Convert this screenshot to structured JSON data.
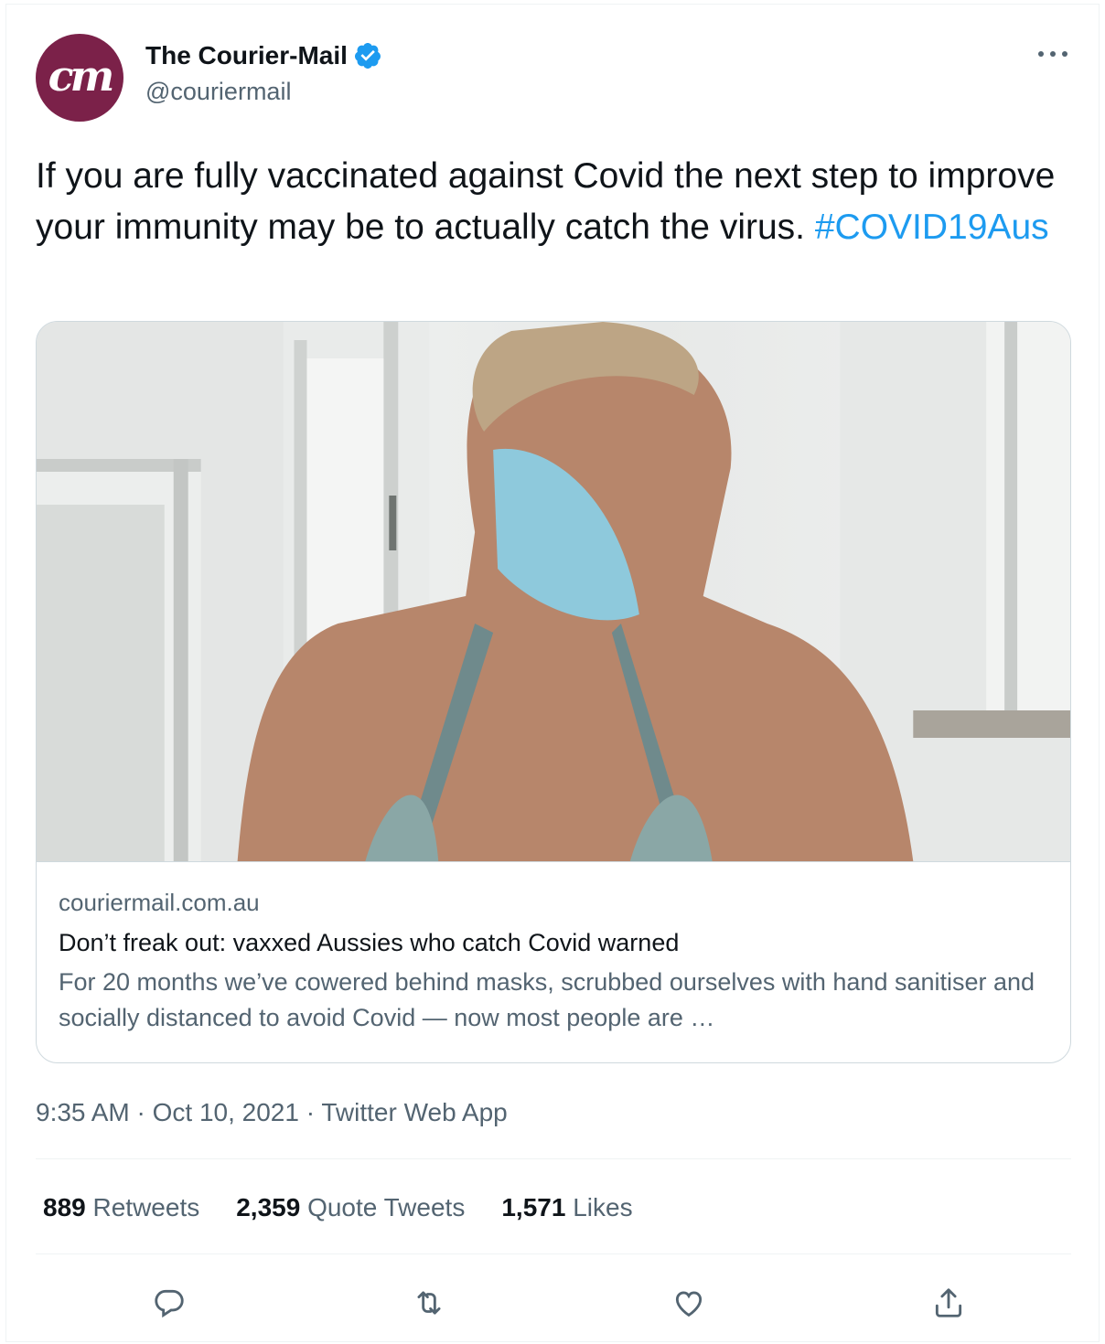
{
  "account": {
    "avatar_text": "cm",
    "display_name": "The Courier-Mail",
    "handle": "@couriermail",
    "verified": true,
    "avatar_color": "#7b2149"
  },
  "tweet": {
    "text": "If you are fully vaccinated against Covid the next step to improve your immunity may be to actually catch the virus.",
    "hashtag": "#COVID19Aus"
  },
  "card": {
    "domain": "couriermail.com.au",
    "title": "Don’t freak out: vaxxed Aussies who catch Covid warned",
    "description": "For 20 months we’ve cowered behind masks, scrubbed ourselves with hand sanitiser and socially distanced to avoid Covid — now most people are …"
  },
  "meta": {
    "time": "9:35 AM",
    "date": "Oct 10, 2021",
    "source": "Twitter Web App"
  },
  "stats": {
    "retweets_count": "889",
    "retweets_label": "Retweets",
    "quotes_count": "2,359",
    "quotes_label": "Quote Tweets",
    "likes_count": "1,571",
    "likes_label": "Likes"
  },
  "icons": {
    "reply": "reply-icon",
    "retweet": "retweet-icon",
    "like": "heart-icon",
    "share": "share-icon",
    "more": "more-icon",
    "verified": "verified-badge-icon"
  },
  "colors": {
    "accent": "#1d9bf0",
    "text_primary": "#0f1419",
    "text_secondary": "#536471",
    "border": "#cfd9de"
  }
}
